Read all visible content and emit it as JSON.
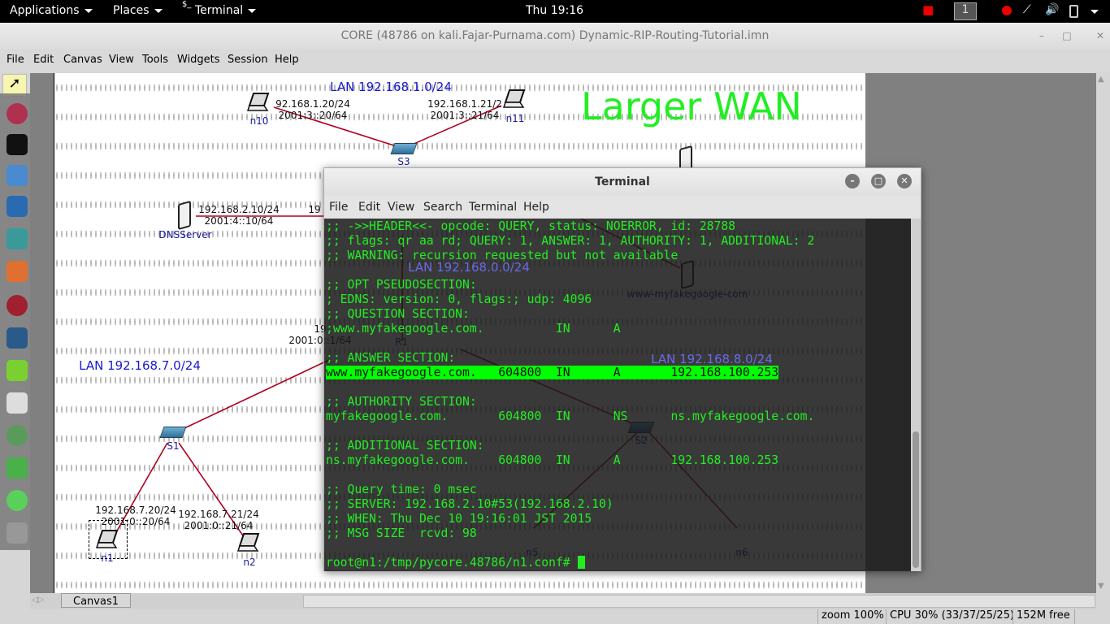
{
  "topbar": {
    "applications": "Applications",
    "places": "Places",
    "terminal": "Terminal",
    "clock": "Thu 19:16",
    "workspace": "1",
    "icons": [
      "camera-icon",
      "record-icon",
      "network-icon",
      "volume-icon",
      "battery-icon",
      "menu-arrow-icon"
    ]
  },
  "window": {
    "title": "CORE (48786 on kali.Fajar-Purnama.com) Dynamic-RIP-Routing-Tutorial.imn"
  },
  "menu": [
    "File",
    "Edit",
    "Canvas",
    "View",
    "Tools",
    "Widgets",
    "Session",
    "Help"
  ],
  "canvas": {
    "lans": [
      "LAN 192.168.1.0/24",
      "LAN 192.168.7.0/24",
      "LAN 192.168.0.0/24",
      "LAN 192.168.8.0/24"
    ],
    "title_text": "Larger WAN",
    "title_color": "#22ee22",
    "nodes": {
      "n10": "n10",
      "n11": "n11",
      "s3": "S3",
      "dns": "DNSServer",
      "s1": "S1",
      "n1": "n1",
      "n2": "n2",
      "r1": "R1",
      "s2": "S2",
      "n5": "n5",
      "n6": "n6",
      "www": "www-myfakegoogle-com"
    },
    "addr": {
      "n10_v4": "92.168.1.20/24",
      "n10_v6": "2001:3::20/64",
      "n11_v4": "192.168.1.21/2",
      "n11_v6": "2001:3::21/64",
      "dns_v4": "192.168.2.10/24",
      "dns_v6": "2001:4::10/64",
      "r_part": "19",
      "n1_v4": "192.168.7.20/24",
      "n1_v6": "2001:0::20/64",
      "n2_v4": "192.168.7.21/24",
      "n2_v6": "2001:0::21/64",
      "r1_v4": "19",
      "r1_v6": "2001:0::1/64"
    },
    "tab": "Canvas1"
  },
  "terminal": {
    "title": "Terminal",
    "menu": [
      "File",
      "Edit",
      "View",
      "Search",
      "Terminal",
      "Help"
    ],
    "lines": [
      ";; ->>HEADER<<- opcode: QUERY, status: NOERROR, id: 28788",
      ";; flags: qr aa rd; QUERY: 1, ANSWER: 1, AUTHORITY: 1, ADDITIONAL: 2",
      ";; WARNING: recursion requested but not available",
      "",
      ";; OPT PSEUDOSECTION:",
      "; EDNS: version: 0, flags:; udp: 4096",
      ";; QUESTION SECTION:",
      ";www.myfakegoogle.com.\t\tIN\tA",
      "",
      ";; ANSWER SECTION:"
    ],
    "highlight": "www.myfakegoogle.com.\t604800\tIN\tA\t192.168.100.253",
    "lines2": [
      "",
      ";; AUTHORITY SECTION:",
      "myfakegoogle.com.\t604800\tIN\tNS\tns.myfakegoogle.com.",
      "",
      ";; ADDITIONAL SECTION:",
      "ns.myfakegoogle.com.\t604800\tIN\tA\t192.168.100.253",
      "",
      ";; Query time: 0 msec",
      ";; SERVER: 192.168.2.10#53(192.168.2.10)",
      ";; WHEN: Thu Dec 10 19:16:01 JST 2015",
      ";; MSG SIZE  rcvd: 98",
      ""
    ],
    "prompt": "root@n1:/tmp/pycore.48786/n1.conf# "
  },
  "status": {
    "zoom": "zoom 100%",
    "cpu": "CPU 30% (33/37/25/25)",
    "mem": "152M free"
  }
}
